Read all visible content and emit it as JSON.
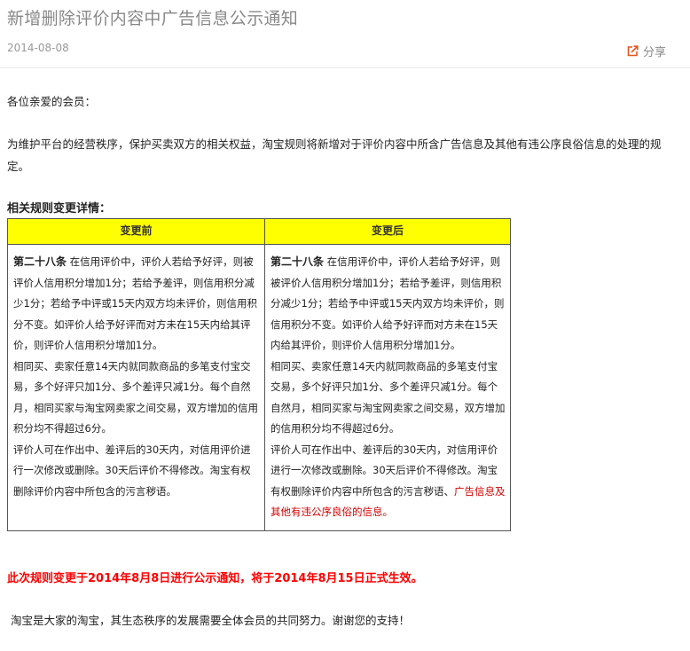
{
  "article": {
    "title": "新增删除评价内容中广告信息公示通知",
    "date": "2014-08-08",
    "share_label": "分享"
  },
  "icons": {
    "share": "share-arrow-icon"
  },
  "colors": {
    "header_bg": "#ffff00",
    "notice": "#ff0000",
    "highlight": "#d40000",
    "share_icon": "#e8541e"
  },
  "body": {
    "greeting": "各位亲爱的会员：",
    "intro": "为维护平台的经营秩序，保护买卖双方的相关权益，淘宝规则将新增对于评价内容中所含广告信息及其他有违公序良俗信息的处理的规定。",
    "section_title": "相关规则变更详情：",
    "notice": "此次规则变更于2014年8月8日进行公示通知，将于2014年8月15日正式生效。",
    "closing": "淘宝是大家的淘宝，其生态秩序的发展需要全体会员的共同努力。谢谢您的支持！"
  },
  "table": {
    "headers": [
      "变更前",
      "变更后"
    ],
    "before": {
      "article_label": "第二十八条",
      "p1": "在信用评价中，评价人若给予好评，则被评价人信用积分增加1分；若给予差评，则信用积分减少1分；若给予中评或15天内双方均未评价，则信用积分不变。如评价人给予好评而对方未在15天内给其评价，则评价人信用积分增加1分。",
      "p2": "相同买、卖家任意14天内就同款商品的多笔支付宝交易，多个好评只加1分、多个差评只减1分。每个自然月，相同买家与淘宝网卖家之间交易，双方增加的信用积分均不得超过6分。",
      "p3": "评价人可在作出中、差评后的30天内，对信用评价进行一次修改或删除。30天后评价不得修改。淘宝有权删除评价内容中所包含的污言秽语。"
    },
    "after": {
      "article_label": "第二十八条",
      "p1": "在信用评价中，评价人若给予好评，则被评价人信用积分增加1分；若给予差评，则信用积分减少1分；若给予中评或15天内双方均未评价，则信用积分不变。如评价人给予好评而对方未在15天内给其评价，则评价人信用积分增加1分。",
      "p2": "相同买、卖家任意14天内就同款商品的多笔支付宝交易，多个好评只加1分、多个差评只减1分。每个自然月，相同买家与淘宝网卖家之间交易，双方增加的信用积分均不得超过6分。",
      "p3": "评价人可在作出中、差评后的30天内，对信用评价进行一次修改或删除。30天后评价不得修改。淘宝有权删除评价内容中所包含的污言秽语、",
      "p3_highlight": "广告信息及其他有违公序良俗的信息。"
    }
  }
}
